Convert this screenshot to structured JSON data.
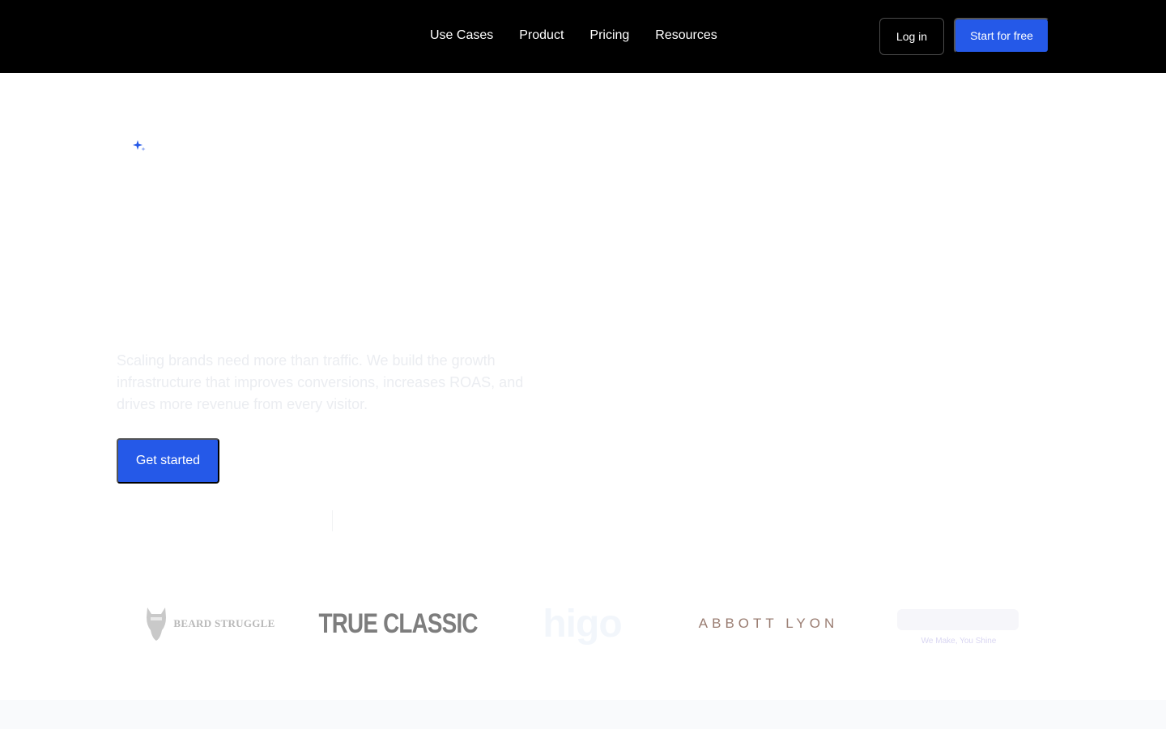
{
  "nav": {
    "links": [
      {
        "label": "Use Cases"
      },
      {
        "label": "Product"
      },
      {
        "label": "Pricing"
      },
      {
        "label": "Resources"
      }
    ],
    "login_label": "Log in",
    "start_label": "Start for free"
  },
  "hero": {
    "sparkle_icon": "sparkle-icon",
    "subtitle": "Scaling brands need more than traffic. We build the growth infrastructure that improves conversions, increases ROAS, and drives more revenue from every visitor.",
    "cta_label": "Get started"
  },
  "logos": {
    "beard_struggle": "BEARD STRUGGLE",
    "true_classic": "TRUE CLASSIC",
    "higo": "higo",
    "abbott_lyon": "ABBOTT LYON",
    "last_tagline": "We Make, You Shine"
  },
  "colors": {
    "nav_bg": "#000000",
    "accent": "#2559e8",
    "subtitle_text": "#ebedf1"
  }
}
